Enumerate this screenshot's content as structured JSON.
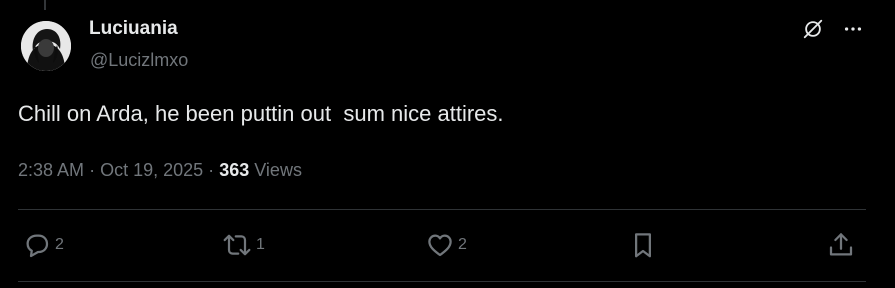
{
  "user": {
    "display_name": "Luciuania",
    "handle": "@Lucizlmxo"
  },
  "tweet": {
    "text": "Chill on Arda, he been puttin out  sum nice attires."
  },
  "meta": {
    "time": "2:38 AM",
    "separator": "·",
    "date": "Oct 19, 2025",
    "views_count": "363",
    "views_label": "Views"
  },
  "actions": {
    "replies": "2",
    "reposts": "1",
    "likes": "2"
  },
  "icons": {
    "grok": "grok-icon",
    "more": "more-icon",
    "reply": "reply-icon",
    "repost": "repost-icon",
    "like": "like-icon",
    "bookmark": "bookmark-icon",
    "share": "share-icon"
  },
  "colors": {
    "background": "#000000",
    "primary_text": "#e7e9ea",
    "secondary_text": "#71767b",
    "divider": "#2f3336"
  }
}
